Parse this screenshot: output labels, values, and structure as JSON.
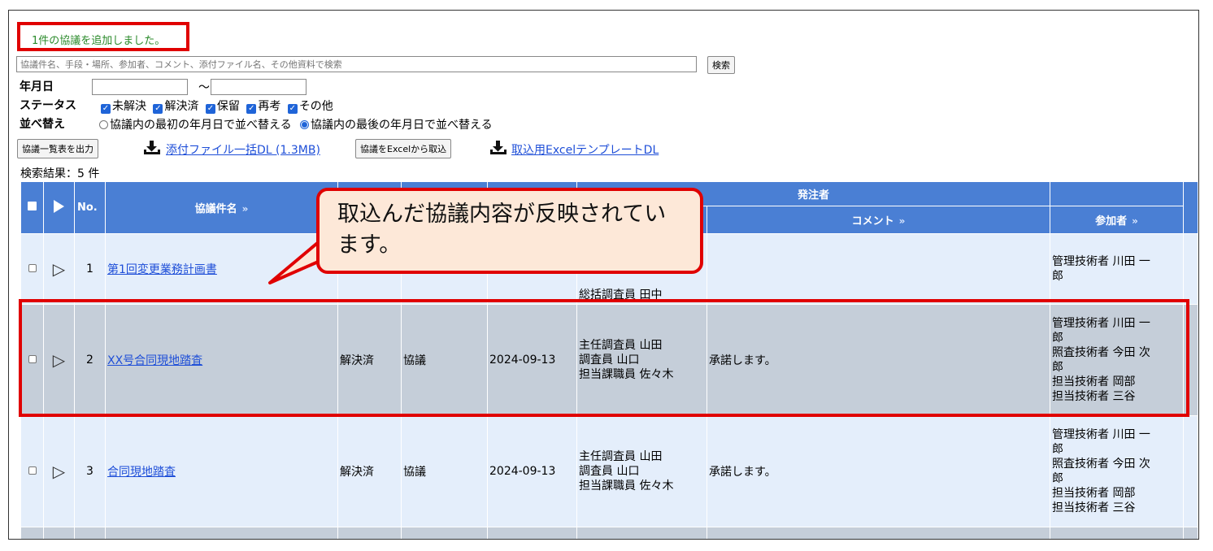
{
  "notice": "1件の協議を追加しました。",
  "search": {
    "placeholder": "協議件名、手段・場所、参加者、コメント、添付ファイル名、その他資料で検索",
    "button": "検索"
  },
  "filters": {
    "date_label": "年月日",
    "date_separator": "～",
    "status_label": "ステータス",
    "statuses": [
      "未解決",
      "解決済",
      "保留",
      "再考",
      "その他"
    ],
    "sort_label": "並べ替え",
    "sort_options": [
      "協議内の最初の年月日で並べ替える",
      "協議内の最後の年月日で並べ替える"
    ],
    "sort_selected": 1
  },
  "tools": {
    "export_button": "協議一覧表を出力",
    "attachment_dl": "添付ファイル一括DL (1.3MB)",
    "import_button": "協議をExcelから取込",
    "template_dl": "取込用ExcelテンプレートDL"
  },
  "result_count": "検索結果：5 件",
  "table": {
    "header_no": "No.",
    "header_title": "協議件名",
    "header_group": "発注者",
    "header_comment": "コメント",
    "header_participants": "参加者",
    "sort_mark": "»",
    "rows": [
      {
        "no": "1",
        "title": "第1回変更業務計画書",
        "status": "",
        "method": "",
        "date": "",
        "client": "総括調査員 田中",
        "comment": "",
        "participants": "管理技術者 川田 一\n郎"
      },
      {
        "no": "2",
        "title": "XX号合同現地踏査",
        "status": "解決済",
        "method": "協議",
        "date": "2024-09-13",
        "client": "主任調査員 山田\n調査員 山口\n担当課職員 佐々木",
        "comment": "承諾します。",
        "participants": "管理技術者 川田 一\n郎\n照査技術者 今田 次\n郎\n担当技術者 岡部\n担当技術者 三谷"
      },
      {
        "no": "3",
        "title": "合同現地踏査",
        "status": "解決済",
        "method": "協議",
        "date": "2024-09-13",
        "client": "主任調査員 山田\n調査員 山口\n担当課職員 佐々木",
        "comment": "承諾します。",
        "participants": "管理技術者 川田 一\n郎\n照査技術者 今田 次\n郎\n担当技術者 岡部\n担当技術者 三谷"
      }
    ]
  },
  "callout": "取込んだ協議内容が反映されています。",
  "colors": {
    "header_blue": "#4a7fd4",
    "row_blue": "#e4eefb",
    "row_grey": "#c5ced9",
    "highlight_red": "#e00000",
    "notice_green": "#2a8a2a",
    "callout_fill": "#fde8d8"
  }
}
